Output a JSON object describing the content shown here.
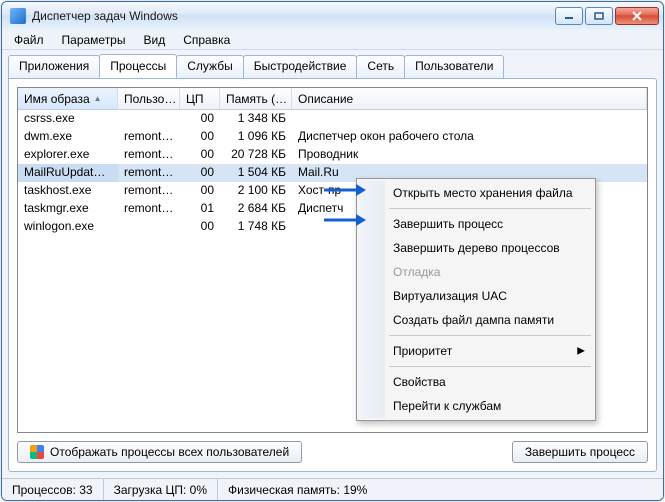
{
  "window": {
    "title": "Диспетчер задач Windows"
  },
  "menu": {
    "file": "Файл",
    "options": "Параметры",
    "view": "Вид",
    "help": "Справка"
  },
  "tabs": {
    "apps": "Приложения",
    "processes": "Процессы",
    "services": "Службы",
    "performance": "Быстродействие",
    "network": "Сеть",
    "users": "Пользователи"
  },
  "columns": {
    "image": "Имя образа",
    "user": "Пользо…",
    "cpu": "ЦП",
    "memory": "Память (…",
    "description": "Описание"
  },
  "rows": [
    {
      "img": "csrss.exe",
      "user": "",
      "cpu": "00",
      "mem": "1 348 КБ",
      "desc": ""
    },
    {
      "img": "dwm.exe",
      "user": "remont…",
      "cpu": "00",
      "mem": "1 096 КБ",
      "desc": "Диспетчер окон рабочего стола"
    },
    {
      "img": "explorer.exe",
      "user": "remont…",
      "cpu": "00",
      "mem": "20 728 КБ",
      "desc": "Проводник"
    },
    {
      "img": "MailRuUpdate…",
      "user": "remont…",
      "cpu": "00",
      "mem": "1 504 КБ",
      "desc": "Mail.Ru"
    },
    {
      "img": "taskhost.exe",
      "user": "remont…",
      "cpu": "00",
      "mem": "2 100 КБ",
      "desc": "Хост-пр"
    },
    {
      "img": "taskmgr.exe",
      "user": "remont…",
      "cpu": "01",
      "mem": "2 684 КБ",
      "desc": "Диспетч"
    },
    {
      "img": "winlogon.exe",
      "user": "",
      "cpu": "00",
      "mem": "1 748 КБ",
      "desc": ""
    }
  ],
  "selected_index": 3,
  "buttons": {
    "show_all": "Отображать процессы всех пользователей",
    "end_process": "Завершить процесс"
  },
  "status": {
    "processes_label": "Процессов:",
    "processes_value": "33",
    "cpu_label": "Загрузка ЦП:",
    "cpu_value": "0%",
    "mem_label": "Физическая память:",
    "mem_value": "19%"
  },
  "context_menu": {
    "open_location": "Открыть место хранения файла",
    "end_process": "Завершить процесс",
    "end_tree": "Завершить дерево процессов",
    "debug": "Отладка",
    "uac": "Виртуализация UAC",
    "dump": "Создать файл дампа памяти",
    "priority": "Приоритет",
    "properties": "Свойства",
    "goto_services": "Перейти к службам"
  }
}
